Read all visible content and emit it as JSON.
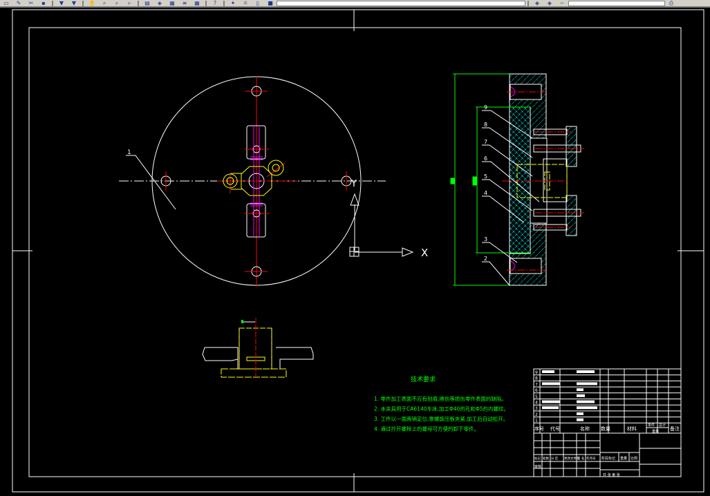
{
  "toolbar": {
    "icons": [
      "save-icon",
      "pencil-icon",
      "cut-icon",
      "paste-icon",
      "arrow-down-icon",
      "arrow-down-icon",
      "pan-icon",
      "zoom-icon",
      "zoom-window-icon",
      "zoom-previous-icon",
      "properties-icon",
      "layer-icon",
      "toolpalette-icon",
      "stack-icon",
      "calculator-icon",
      "help-icon"
    ],
    "layer_icons": [
      "bulb-icon",
      "sun-icon",
      "lock-icon",
      "color-square-icon"
    ],
    "right_icons": [
      "layer-previous-icon",
      "layer-icon",
      "linetype-icon",
      "print-icon"
    ]
  },
  "drawing": {
    "colors": {
      "background": "#000000",
      "outline": "#ffffff",
      "centerline": "#ff0000",
      "dimension": "#00ff00",
      "hatch": "#00ffff",
      "hidden": "#ffff00",
      "bolt": "#ff00ff"
    },
    "plan_view": {
      "leader_label": "1"
    },
    "ucs": {
      "x_label": "X",
      "y_label": "Y"
    },
    "section_view": {
      "balloons": [
        "9",
        "8",
        "7",
        "6",
        "5",
        "4",
        "3",
        "2"
      ]
    },
    "technical_requirements": {
      "title": "技术要求",
      "notes": [
        "1. 零件加工表面不应有划痕,擦伤等损伤零件表面的缺陷。",
        "2. 本夹具用于CA6140车床,加工Φ40的孔和Φ5的内螺纹。",
        "3. 工件以一面两销定位,靠螺旋压板夹紧,加工后自动松开。",
        "4. 通过拧开螺栓上的螺母可方便的卸下零件。"
      ]
    },
    "parts_list": {
      "row_numbers": [
        "9",
        "8",
        "7",
        "6",
        "5",
        "4",
        "3",
        "2",
        "1"
      ],
      "header": {
        "no": "序号",
        "code": "代号",
        "name": "名称",
        "qty": "数量",
        "material": "材料",
        "unit_weight": "单件",
        "total_weight": "总计",
        "weight": "重量",
        "remarks": "备注"
      }
    },
    "title_block": {
      "approval_row": [
        "标记",
        "处数",
        "分 区",
        "更改文件号",
        "签 名",
        "年月日"
      ],
      "stage_label": "阶段标记",
      "weight_label": "重量",
      "scale_label": "比例",
      "sheet_label": "共  张  第  张",
      "audit_label": "审核"
    }
  }
}
